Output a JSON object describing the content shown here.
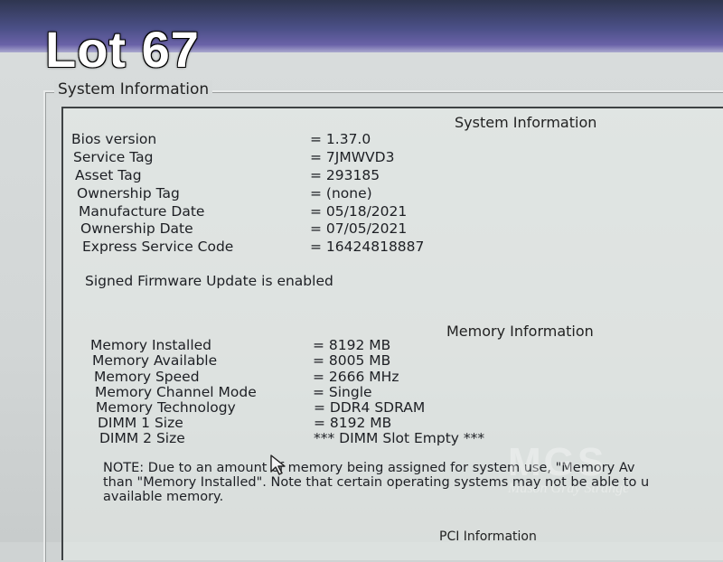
{
  "overlay": {
    "lot_label": "Lot 67"
  },
  "group": {
    "title": "System Information"
  },
  "system_info": {
    "heading": "System Information",
    "rows": [
      {
        "label": "Bios version",
        "value": "= 1.37.0"
      },
      {
        "label": "Service Tag",
        "value": "= 7JMWVD3"
      },
      {
        "label": "Asset Tag",
        "value": "= 293185"
      },
      {
        "label": "Ownership Tag",
        "value": "= (none)"
      },
      {
        "label": "Manufacture Date",
        "value": "= 05/18/2021"
      },
      {
        "label": "Ownership Date",
        "value": "= 07/05/2021"
      },
      {
        "label": "Express Service Code",
        "value": "= 16424818887"
      }
    ],
    "signed_firmware": "Signed Firmware Update is enabled"
  },
  "memory_info": {
    "heading": "Memory Information",
    "rows": [
      {
        "label": "Memory Installed",
        "value": "= 8192 MB"
      },
      {
        "label": "Memory Available",
        "value": "= 8005 MB"
      },
      {
        "label": "Memory Speed",
        "value": "= 2666 MHz"
      },
      {
        "label": "Memory Channel Mode",
        "value": "= Single"
      },
      {
        "label": "Memory Technology",
        "value": "= DDR4 SDRAM"
      },
      {
        "label": "DIMM 1 Size",
        "value": "= 8192 MB"
      },
      {
        "label": "DIMM 2 Size",
        "value": "*** DIMM Slot Empty ***"
      }
    ],
    "note_lines": [
      "NOTE: Due to an amount of memory being assigned for system use, \"Memory Av",
      "than \"Memory Installed\". Note that certain operating systems may not be able to u",
      "available memory."
    ]
  },
  "pci_info": {
    "heading": "PCI Information"
  },
  "watermark": {
    "brand": "MGS",
    "name": "Mason Gray Strange"
  },
  "icons": {
    "cursor": "mouse-pointer-icon"
  },
  "colors": {
    "screen_bg": "#d2d6d6",
    "top_band": "#4a4f86",
    "text": "#1d1f24"
  }
}
